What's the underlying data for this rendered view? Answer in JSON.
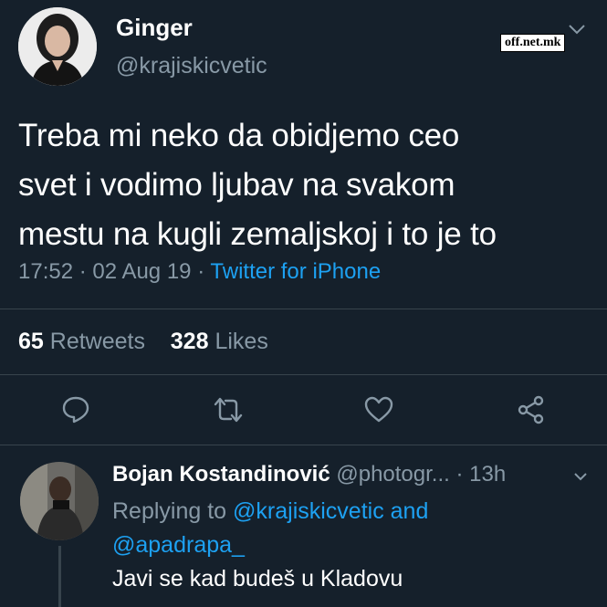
{
  "tweet": {
    "author_name": "Ginger",
    "author_handle": "@krajiskicvetic",
    "text": "Treba mi neko da obidjemo ceo\nsvet i vodimo ljubav na svakom\nmestu na kugli zemaljskoj i to je to",
    "time": "17:52",
    "date": "02 Aug 19",
    "source": "Twitter for iPhone",
    "retweets_count": "65",
    "retweets_label": "Retweets",
    "likes_count": "328",
    "likes_label": "Likes"
  },
  "watermark": "off.net.mk",
  "actions": [
    "reply-icon",
    "retweet-icon",
    "like-icon",
    "share-icon"
  ],
  "reply": {
    "author_name": "Bojan Kostandinović",
    "author_handle": "@photogr...",
    "time": "13h",
    "replying_prefix": "Replying to",
    "replying_to_1": "@krajiskicvetic and",
    "replying_to_2": "@apadrapa_",
    "text": "Javi se kad budeš u Kladovu"
  },
  "colors": {
    "background": "#15202b",
    "muted": "#8899a6",
    "link": "#1da1f2",
    "divider": "#38444d"
  }
}
